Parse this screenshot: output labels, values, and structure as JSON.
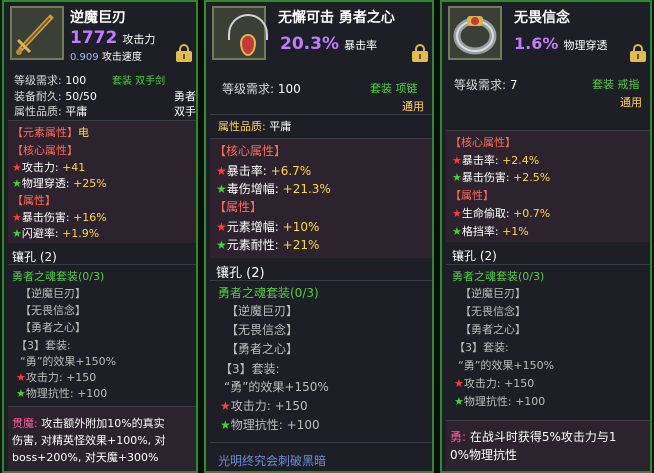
{
  "cards": [
    {
      "name": "逆魔巨刃",
      "icon": "dagger-icon",
      "main_value": "1772",
      "main_label": "攻击力",
      "sub_value": "0.909",
      "sub_label": "攻击速度",
      "type_line": "套装 双手剑",
      "req_label": "等级需求:",
      "req_value": "100",
      "dur_label": "装备耐久:",
      "dur_value": "50/50",
      "dur_right": "勇者",
      "quality_label": "属性品质:",
      "quality_value": "平庸",
      "quality_right": "双手",
      "element_header": "【元素属性】",
      "element_value": "电",
      "core_header": "【核心属性】",
      "core": [
        {
          "name": "攻击力:",
          "value": "+41"
        },
        {
          "name": "物理穿透:",
          "value": "+25%"
        }
      ],
      "attr_header": "【属性】",
      "attrs": [
        {
          "name": "暴击伤害:",
          "value": "+16%"
        },
        {
          "name": "闪避率:",
          "value": "+1.9%"
        }
      ],
      "socket": "镶孔 (2)",
      "set_title": "勇者之魂套装(0/3)",
      "set_items": [
        "【逆魔巨刃】",
        "【无畏信念】",
        "【勇者之心】"
      ],
      "set_bonus_title": "【3】套装:",
      "set_bonus": "“勇”的效果+150%",
      "set_stats": [
        "攻击力: +150",
        "物理抗性: +100"
      ],
      "skill_name": "贯魔:",
      "skill_text": [
        "攻击额外附加10%的真实",
        "伤害, 对精英怪效果+100%, 对",
        "boss+200%, 对天魔+300%"
      ]
    },
    {
      "name": "无懈可击 勇者之心",
      "icon": "amulet-icon",
      "main_value": "20.3%",
      "main_label": "暴击率",
      "type_line_1": "套装 项链",
      "type_line_2": "通用",
      "req_label": "等级需求:",
      "req_value": "100",
      "quality_label": "属性品质:",
      "quality_value": "平庸",
      "core_header": "【核心属性】",
      "core": [
        {
          "name": "暴击率:",
          "value": "+6.7%"
        },
        {
          "name": "毒伤增幅:",
          "value": "+21.3%"
        }
      ],
      "attr_header": "【属性】",
      "attrs": [
        {
          "name": "元素增幅:",
          "value": "+10%"
        },
        {
          "name": "元素耐性:",
          "value": "+21%"
        }
      ],
      "socket": "镶孔 (2)",
      "set_title": "勇者之魂套装(0/3)",
      "set_items": [
        "【逆魔巨刃】",
        "【无畏信念】",
        "【勇者之心】"
      ],
      "set_bonus_title": "【3】套装:",
      "set_bonus": "“勇”的效果+150%",
      "set_stats": [
        "攻击力: +150",
        "物理抗性: +100"
      ],
      "footer": "光明终究会刺破黑暗"
    },
    {
      "name": "无畏信念",
      "icon": "ring-icon",
      "main_value": "1.6%",
      "main_label": "物理穿透",
      "type_line_1": "套装 戒指",
      "type_line_2": "通用",
      "req_label": "等级需求:",
      "req_value": "7",
      "core_header": "【核心属性】",
      "core": [
        {
          "name": "暴击率:",
          "value": "+2.4%"
        },
        {
          "name": "暴击伤害:",
          "value": "+2.5%"
        }
      ],
      "attr_header": "【属性】",
      "attrs": [
        {
          "name": "生命偷取:",
          "value": "+0.7%"
        },
        {
          "name": "格挡率:",
          "value": "+1%"
        }
      ],
      "socket": "镶孔 (2)",
      "set_title": "勇者之魂套装(0/3)",
      "set_items": [
        "【逆魔巨刃】",
        "【无畏信念】",
        "【勇者之心】"
      ],
      "set_bonus_title": "【3】套装:",
      "set_bonus": "“勇”的效果+150%",
      "set_stats": [
        "攻击力: +150",
        "物理抗性: +100"
      ],
      "skill_name": "勇:",
      "skill_text": [
        "在战斗时获得5%攻击力与1",
        "0%物理抗性"
      ]
    }
  ],
  "colors": {
    "frame": "#2f8a2f",
    "panel": "#1e1e26",
    "purple_value": "#c07cff",
    "red_header": "#ff6a5a",
    "set_green": "#4fcf3f",
    "gold_value": "#ffd84a",
    "lock": "#e0bd4e"
  }
}
